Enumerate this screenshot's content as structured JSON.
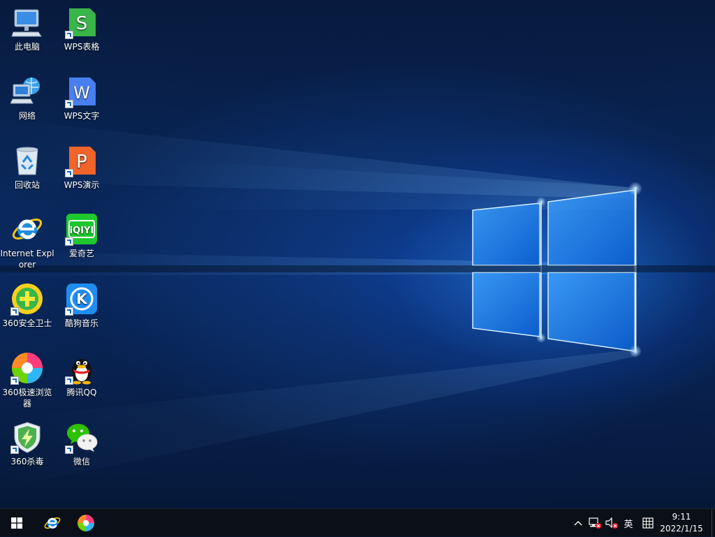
{
  "desktop": {
    "icons": [
      {
        "id": "this-pc",
        "label": "此电脑"
      },
      {
        "id": "network",
        "label": "网络"
      },
      {
        "id": "recycle-bin",
        "label": "回收站"
      },
      {
        "id": "internet-explorer",
        "label": "Internet Explorer"
      },
      {
        "id": "360-safe",
        "label": "360安全卫士"
      },
      {
        "id": "360-browser",
        "label": "360极速浏览器"
      },
      {
        "id": "360-antivirus",
        "label": "360杀毒"
      },
      {
        "id": "wps-spreadsheet",
        "label": "WPS表格"
      },
      {
        "id": "wps-writer",
        "label": "WPS文字"
      },
      {
        "id": "wps-presentation",
        "label": "WPS演示"
      },
      {
        "id": "iqiyi",
        "label": "爱奇艺"
      },
      {
        "id": "kugou-music",
        "label": "酷狗音乐"
      },
      {
        "id": "tencent-qq",
        "label": "腾讯QQ"
      },
      {
        "id": "wechat",
        "label": "微信"
      }
    ]
  },
  "taskbar": {
    "start_icon": "windows-logo-icon",
    "pinned": [
      {
        "id": "ie",
        "icon": "internet-explorer-icon"
      },
      {
        "id": "360-browser",
        "icon": "360-browser-icon"
      }
    ],
    "tray": {
      "ime_label": "英",
      "clock_time": "9:11",
      "clock_date": "2022/1/15"
    }
  },
  "colors": {
    "taskbar_bg": "#0b0f17",
    "wallpaper_glow": "#2a8cff",
    "wps_green": "#3ab54a",
    "wps_blue": "#4a7ff0",
    "wps_orange": "#f0642a"
  }
}
